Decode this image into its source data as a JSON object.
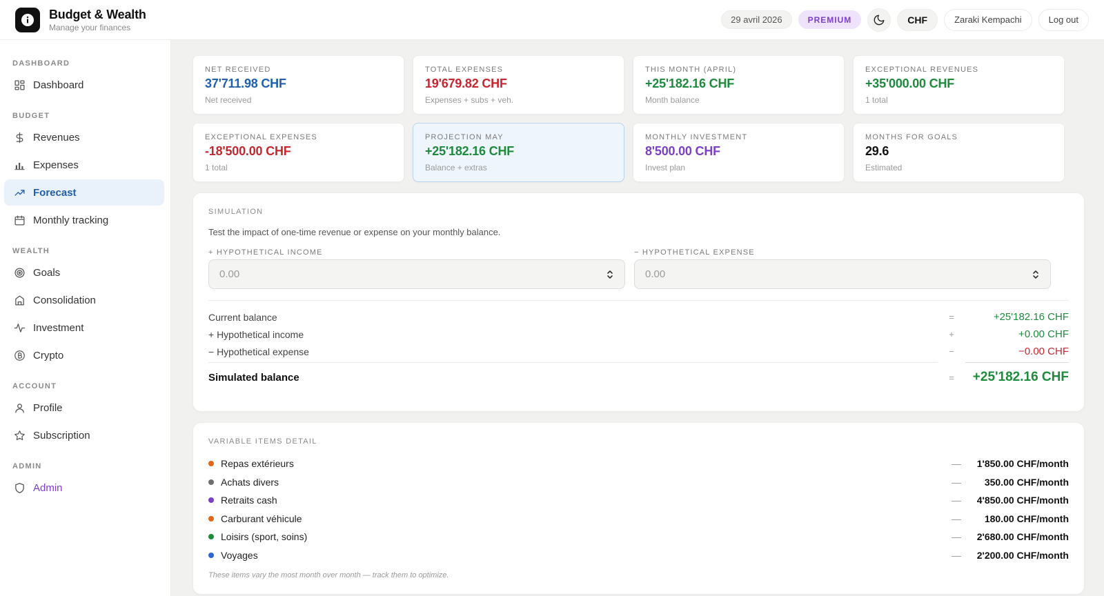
{
  "app": {
    "title": "Budget & Wealth",
    "subtitle": "Manage your finances"
  },
  "header": {
    "date": "29 avril 2026",
    "plan": "PREMIUM",
    "currency": "CHF",
    "user": "Zaraki Kempachi",
    "logout": "Log out",
    "theme_icon": "moon-icon"
  },
  "sidebar": {
    "sections": [
      {
        "label": "DASHBOARD",
        "items": [
          {
            "label": "Dashboard",
            "icon": "dashboard-grid-icon"
          }
        ]
      },
      {
        "label": "BUDGET",
        "items": [
          {
            "label": "Revenues",
            "icon": "dollar-icon"
          },
          {
            "label": "Expenses",
            "icon": "bar-chart-icon"
          },
          {
            "label": "Forecast",
            "icon": "trending-up-icon",
            "active": true
          },
          {
            "label": "Monthly tracking",
            "icon": "calendar-icon"
          }
        ]
      },
      {
        "label": "WEALTH",
        "items": [
          {
            "label": "Goals",
            "icon": "target-icon"
          },
          {
            "label": "Consolidation",
            "icon": "bank-icon"
          },
          {
            "label": "Investment",
            "icon": "activity-icon"
          },
          {
            "label": "Crypto",
            "icon": "bitcoin-icon"
          }
        ]
      },
      {
        "label": "ACCOUNT",
        "items": [
          {
            "label": "Profile",
            "icon": "user-icon"
          },
          {
            "label": "Subscription",
            "icon": "star-icon"
          }
        ]
      },
      {
        "label": "ADMIN",
        "items": [
          {
            "label": "Admin",
            "icon": "shield-icon"
          }
        ]
      }
    ]
  },
  "stats": [
    {
      "label": "NET RECEIVED",
      "value": "37'711.98 CHF",
      "sub": "Net received",
      "color": "#1f5fb0"
    },
    {
      "label": "TOTAL EXPENSES",
      "value": "19'679.82 CHF",
      "sub": "Expenses + subs + veh.",
      "color": "#c4272d"
    },
    {
      "label": "THIS MONTH (APRIL)",
      "value": "+25'182.16 CHF",
      "sub": "Month balance",
      "color": "#1d8a3c"
    },
    {
      "label": "EXCEPTIONAL REVENUES",
      "value": "+35'000.00 CHF",
      "sub": "1 total",
      "color": "#1d8a3c"
    },
    {
      "label": "EXCEPTIONAL EXPENSES",
      "value": "-18'500.00 CHF",
      "sub": "1 total",
      "color": "#c4272d"
    },
    {
      "label": "PROJECTION MAY",
      "value": "+25'182.16 CHF",
      "sub": "Balance + extras",
      "color": "#1d8a3c"
    },
    {
      "label": "MONTHLY INVESTMENT",
      "value": "8'500.00 CHF",
      "sub": "Invest plan",
      "color": "#7b3fc9"
    },
    {
      "label": "MONTHS FOR GOALS",
      "value": "29.6",
      "sub": "Estimated",
      "color": "#111111"
    }
  ],
  "simulation": {
    "title": "SIMULATION",
    "description": "Test the impact of one-time revenue or expense on your monthly balance.",
    "income_label": "+ HYPOTHETICAL INCOME",
    "income_placeholder": "0.00",
    "expense_label": "− HYPOTHETICAL EXPENSE",
    "expense_placeholder": "0.00",
    "rows": [
      {
        "label": "Current balance",
        "op": "=",
        "amount": "+25'182.16 CHF",
        "color": "#1d8a3c"
      },
      {
        "label": "+ Hypothetical income",
        "op": "+",
        "amount": "+0.00 CHF",
        "color": "#1d8a3c"
      },
      {
        "label": "− Hypothetical expense",
        "op": "−",
        "amount": "−0.00 CHF",
        "color": "#c4272d"
      }
    ],
    "total": {
      "label": "Simulated balance",
      "op": "=",
      "amount": "+25'182.16 CHF"
    }
  },
  "variable_items": {
    "title": "VARIABLE ITEMS DETAIL",
    "items": [
      {
        "label": "Repas extérieurs",
        "amount": "1'850.00 CHF/month",
        "color": "#e0671b"
      },
      {
        "label": "Achats divers",
        "amount": "350.00 CHF/month",
        "color": "#6e6e6e"
      },
      {
        "label": "Retraits cash",
        "amount": "4'850.00 CHF/month",
        "color": "#7b3fc9"
      },
      {
        "label": "Carburant véhicule",
        "amount": "180.00 CHF/month",
        "color": "#e0671b"
      },
      {
        "label": "Loisirs (sport, soins)",
        "amount": "2'680.00 CHF/month",
        "color": "#1d8a3c"
      },
      {
        "label": "Voyages",
        "amount": "2'200.00 CHF/month",
        "color": "#2f64d6"
      }
    ],
    "op": "—",
    "note": "These items vary the most month over month — track them to optimize."
  }
}
